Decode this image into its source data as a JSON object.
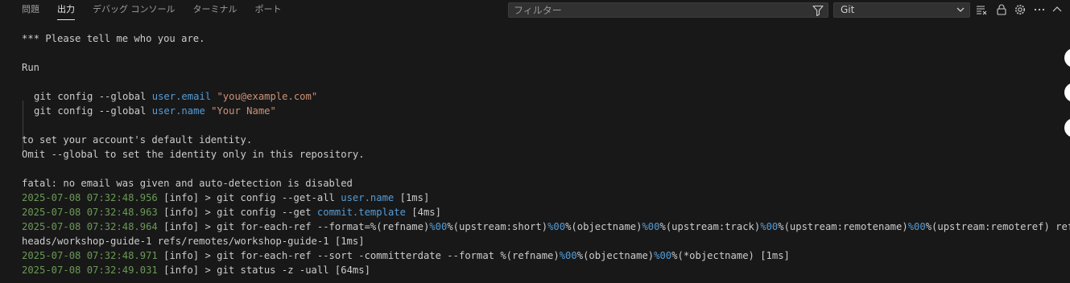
{
  "tabs": [
    {
      "label": "問題",
      "active": false
    },
    {
      "label": "出力",
      "active": true
    },
    {
      "label": "デバッグ コンソール",
      "active": false
    },
    {
      "label": "ターミナル",
      "active": false
    },
    {
      "label": "ポート",
      "active": false
    }
  ],
  "filter": {
    "placeholder": "フィルター",
    "value": ""
  },
  "channel": {
    "selected": "Git"
  },
  "toolbar_icons": [
    "filter-icon",
    "clear-output-icon",
    "lock-icon",
    "gear-icon",
    "more-icon",
    "collapse-icon"
  ],
  "log": {
    "l1": "*** Please tell me who you are.",
    "l2": "Run",
    "l3a": "git config --global ",
    "l3b": "user.email",
    "l3c": " \"you@example.com\"",
    "l4a": "git config --global ",
    "l4b": "user.name",
    "l4c": " \"Your Name\"",
    "l5": "to set your account's default identity.",
    "l6": "Omit --global to set the identity only in this repository.",
    "l7": "fatal: no email was given and auto-detection is disabled",
    "e1_ts": "2025-07-08 07:32:48.956",
    "e1_a": " [info] > git config --get-all ",
    "e1_b": "user.name",
    "e1_c": " [1ms]",
    "e2_ts": "2025-07-08 07:32:48.963",
    "e2_a": " [info] > git config --get ",
    "e2_b": "commit.template",
    "e2_c": " [4ms]",
    "e3_ts": "2025-07-08 07:32:48.964",
    "e3_1": " [info] > git for-each-ref --format=%(refname)",
    "e3_2": "%00",
    "e3_3": "%(upstream:short)",
    "e3_4": "%00",
    "e3_5": "%(objectname)",
    "e3_6": "%00",
    "e3_7": "%(upstream:track)",
    "e3_8": "%00",
    "e3_9": "%(upstream:remotename)",
    "e3_10": "%00",
    "e3_11": "%(upstream:remoteref) refs/",
    "e3_wrap": "heads/workshop-guide-1 refs/remotes/workshop-guide-1 [1ms]",
    "e4_ts": "2025-07-08 07:32:48.971",
    "e4_1": " [info] > git for-each-ref --sort -committerdate --format %(refname)",
    "e4_2": "%00",
    "e4_3": "%(objectname)",
    "e4_4": "%00",
    "e4_5": "%(*objectname) [1ms]",
    "e5_ts": "2025-07-08 07:32:49.031",
    "e5_a": " [info] > git status -z -uall [64ms]"
  }
}
